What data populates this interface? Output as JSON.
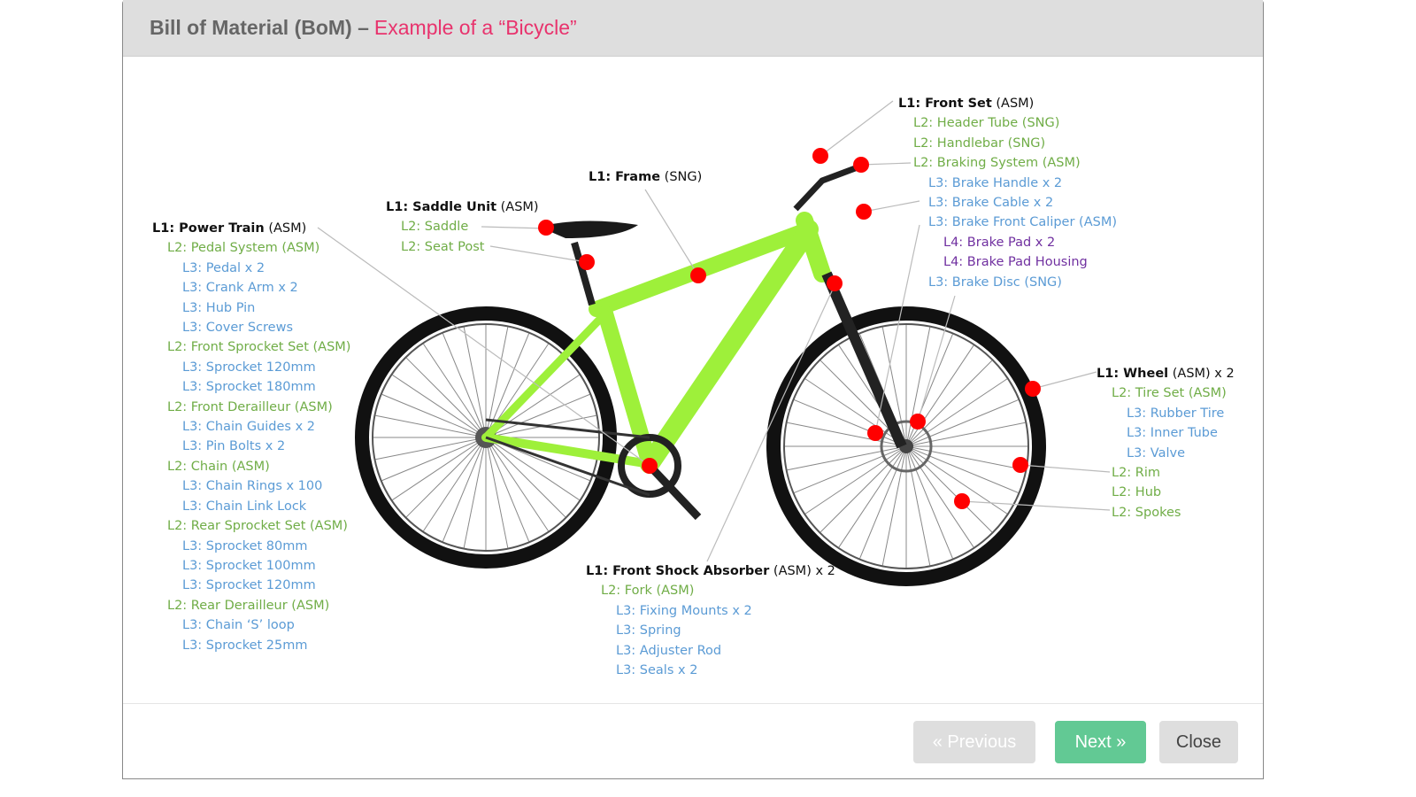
{
  "header": {
    "title_main": "Bill of Material (BoM) –",
    "title_accent": "Example of a “Bicycle”"
  },
  "colors": {
    "accent": "#e8336d",
    "l1": "#111111",
    "l2": "#70ad47",
    "l3": "#5b9bd5",
    "l4": "#7030a0",
    "marker": "#ff0000",
    "bike_frame": "#9ef03a",
    "next_button": "#62c994"
  },
  "groups": [
    {
      "id": "power-train",
      "label": "L1: Power Train",
      "suffix": " (ASM)",
      "items": [
        {
          "level": "L2",
          "text": "L2: Pedal System (ASM)"
        },
        {
          "level": "L3",
          "text": "L3: Pedal x 2"
        },
        {
          "level": "L3",
          "text": "L3: Crank Arm x 2"
        },
        {
          "level": "L3",
          "text": "L3: Hub Pin"
        },
        {
          "level": "L3",
          "text": "L3: Cover Screws"
        },
        {
          "level": "L2",
          "text": "L2: Front Sprocket Set (ASM)"
        },
        {
          "level": "L3",
          "text": "L3: Sprocket 120mm"
        },
        {
          "level": "L3",
          "text": "L3: Sprocket 180mm"
        },
        {
          "level": "L2",
          "text": "L2: Front Derailleur (ASM)"
        },
        {
          "level": "L3",
          "text": "L3: Chain Guides x 2"
        },
        {
          "level": "L3",
          "text": "L3: Pin Bolts x 2"
        },
        {
          "level": "L2",
          "text": "L2: Chain (ASM)"
        },
        {
          "level": "L3",
          "text": "L3: Chain Rings x 100"
        },
        {
          "level": "L3",
          "text": "L3: Chain Link Lock"
        },
        {
          "level": "L2",
          "text": "L2: Rear Sprocket Set (ASM)"
        },
        {
          "level": "L3",
          "text": "L3: Sprocket 80mm"
        },
        {
          "level": "L3",
          "text": "L3: Sprocket 100mm"
        },
        {
          "level": "L3",
          "text": "L3: Sprocket 120mm"
        },
        {
          "level": "L2",
          "text": "L2: Rear Derailleur (ASM)"
        },
        {
          "level": "L3",
          "text": "L3: Chain ‘S’ loop"
        },
        {
          "level": "L3",
          "text": "L3: Sprocket 25mm"
        }
      ]
    },
    {
      "id": "saddle-unit",
      "label": "L1: Saddle Unit",
      "suffix": " (ASM)",
      "items": [
        {
          "level": "L2",
          "text": "L2: Saddle"
        },
        {
          "level": "L2",
          "text": "L2: Seat Post"
        }
      ]
    },
    {
      "id": "frame",
      "label": "L1: Frame",
      "suffix": " (SNG)",
      "items": []
    },
    {
      "id": "front-set",
      "label": "L1: Front Set",
      "suffix": " (ASM)",
      "items": [
        {
          "level": "L2",
          "text": "L2: Header Tube (SNG)"
        },
        {
          "level": "L2",
          "text": "L2: Handlebar (SNG)"
        },
        {
          "level": "L2",
          "text": "L2: Braking System (ASM)"
        },
        {
          "level": "L3",
          "text": "L3: Brake Handle x 2"
        },
        {
          "level": "L3",
          "text": "L3: Brake Cable x 2"
        },
        {
          "level": "L3",
          "text": "L3: Brake Front Caliper (ASM)"
        },
        {
          "level": "L4",
          "text": "L4: Brake Pad x 2"
        },
        {
          "level": "L4",
          "text": "L4: Brake Pad Housing"
        },
        {
          "level": "L3",
          "text": "L3: Brake Disc (SNG)"
        }
      ]
    },
    {
      "id": "wheel",
      "label": "L1: Wheel",
      "suffix": " (ASM) x 2",
      "items": [
        {
          "level": "L2",
          "text": "L2: Tire Set (ASM)"
        },
        {
          "level": "L3",
          "text": "L3: Rubber Tire"
        },
        {
          "level": "L3",
          "text": "L3: Inner Tube"
        },
        {
          "level": "L3",
          "text": "L3: Valve"
        },
        {
          "level": "L2",
          "text": "L2: Rim"
        },
        {
          "level": "L2",
          "text": "L2: Hub"
        },
        {
          "level": "L2",
          "text": "L2: Spokes"
        }
      ]
    },
    {
      "id": "front-shock",
      "label": "L1: Front Shock Absorber",
      "suffix": " (ASM) x 2",
      "items": [
        {
          "level": "L2",
          "text": "L2: Fork (ASM)"
        },
        {
          "level": "L3",
          "text": "L3: Fixing Mounts x 2"
        },
        {
          "level": "L3",
          "text": "L3: Spring"
        },
        {
          "level": "L3",
          "text": "L3: Adjuster Rod"
        },
        {
          "level": "L3",
          "text": "L3: Seals x 2"
        }
      ]
    }
  ],
  "footer": {
    "previous_label": "« Previous",
    "next_label": "Next »",
    "close_label": "Close"
  }
}
